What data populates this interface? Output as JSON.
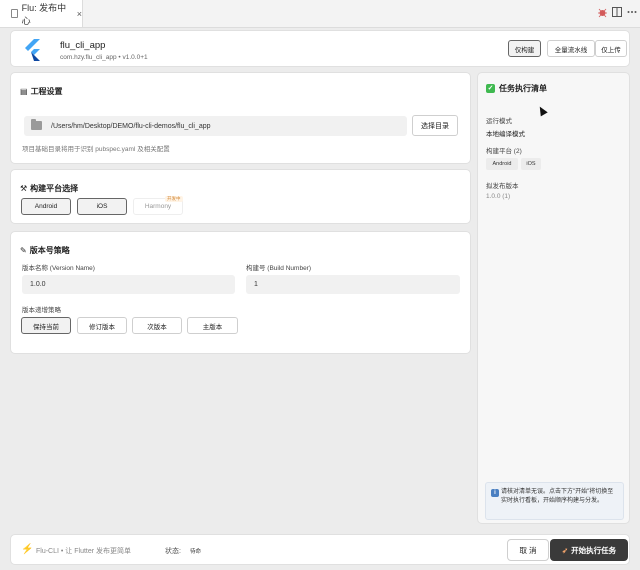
{
  "tab": {
    "label": "Flu: 发布中心",
    "close": "×"
  },
  "titlebar": {
    "bug_icon": "bug-icon",
    "split_icon": "split-editor-icon",
    "more_icon": "more-icon"
  },
  "header": {
    "app_name": "flu_cli_app",
    "app_sub": "com.hzy.flu_cli_app • v1.0.0+1",
    "modes": [
      {
        "label": "仅构建"
      },
      {
        "label": "全量流水线"
      },
      {
        "label": "仅上传"
      }
    ]
  },
  "project": {
    "title": "工程设置",
    "path": "/Users/hm/Desktop/DEMO/flu-cli-demos/flu_cli_app",
    "select_button": "选择目录",
    "hint": "项目基础目录将用于识别 pubspec.yaml 及相关配置"
  },
  "platform": {
    "title": "构建平台选择",
    "options": [
      {
        "label": "Android"
      },
      {
        "label": "iOS"
      },
      {
        "label": "Harmony"
      }
    ],
    "harmony_badge": "开发中"
  },
  "version": {
    "title": "版本号策略",
    "name_label": "版本名称 (Version Name)",
    "name_value": "1.0.0",
    "build_label": "构建号 (Build Number)",
    "build_value": "1",
    "strategy_label": "版本递增策略",
    "strategies": [
      {
        "label": "保持当前"
      },
      {
        "label": "修订版本"
      },
      {
        "label": "次版本"
      },
      {
        "label": "主版本"
      }
    ]
  },
  "checklist": {
    "title": "任务执行清单",
    "mode_label": "运行模式",
    "mode_value": "本地编译模式",
    "platform_label": "构建平台 (2)",
    "platforms": [
      "Android",
      "iOS"
    ],
    "release_label": "拟发布版本",
    "release_value": "1.0.0 (1)",
    "info": "请核对清单无误。点击下方\"开始\"将切换至实时执行看板，开始顺序构建与分发。"
  },
  "footer": {
    "tagline": "Flu-CLI • 让 Flutter 发布更简单",
    "status_label": "状态:",
    "status_value": "待命",
    "cancel": "取 消",
    "start": "开始执行任务"
  },
  "colors": {
    "accent_dark": "#3a3a3a",
    "check_green": "#3fb950",
    "info_blue": "#4a7fc1",
    "flutter_blue": "#42a5f5"
  }
}
